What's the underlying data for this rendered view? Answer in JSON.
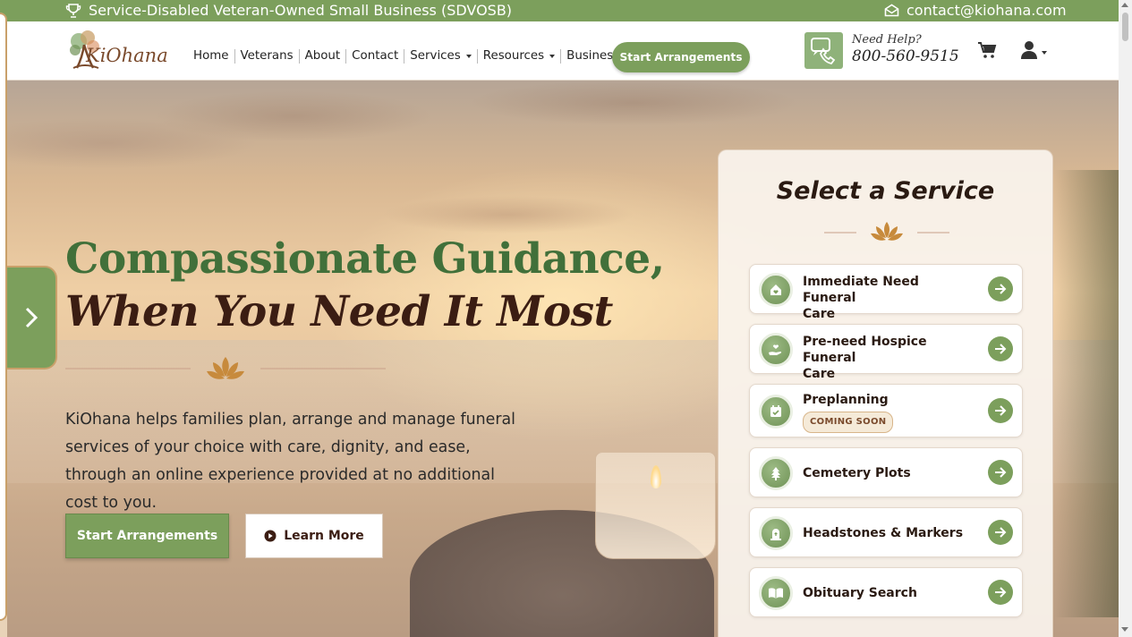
{
  "topbar": {
    "badge_text": "Service-Disabled Veteran-Owned Small Business (SDVOSB)",
    "email": "contact@kiohana.com"
  },
  "header": {
    "logo_text": "KiOhana",
    "nav": [
      {
        "label": "Home"
      },
      {
        "label": "Veterans"
      },
      {
        "label": "About"
      },
      {
        "label": "Contact"
      },
      {
        "label": "Services"
      },
      {
        "label": "Resources"
      },
      {
        "label": "Business"
      }
    ],
    "start_button": "Start Arrangements",
    "help_label": "Need Help?",
    "phone": "800-560-9515"
  },
  "hero": {
    "headline_line1": "Compassionate Guidance,",
    "headline_line2": "When You Need It Most",
    "description": "KiOhana helps families plan, arrange and manage funeral services of your choice with care, dignity, and ease, through an online experience provided at no additional cost to you.",
    "primary_button": "Start Arrangements",
    "secondary_button": "Learn More"
  },
  "services": {
    "title": "Select a Service",
    "items": [
      {
        "line1": "Immediate Need Funeral",
        "line2": "Care",
        "icon": "home-heart-icon"
      },
      {
        "line1": "Pre-need Hospice Funeral",
        "line2": "Care",
        "icon": "hand-heart-icon"
      },
      {
        "line1": "Preplanning",
        "badge": "COMING SOON",
        "icon": "calendar-check-icon"
      },
      {
        "line1": "Cemetery Plots",
        "icon": "tree-icon"
      },
      {
        "line1": "Headstones & Markers",
        "icon": "headstone-icon"
      },
      {
        "line1": "Obituary Search",
        "icon": "book-open-icon"
      }
    ]
  },
  "colors": {
    "brand_green": "#7c9f5c",
    "headline_green": "#41703a",
    "headline_brown": "#3b1d13",
    "accent_gold": "#c9a06a"
  }
}
